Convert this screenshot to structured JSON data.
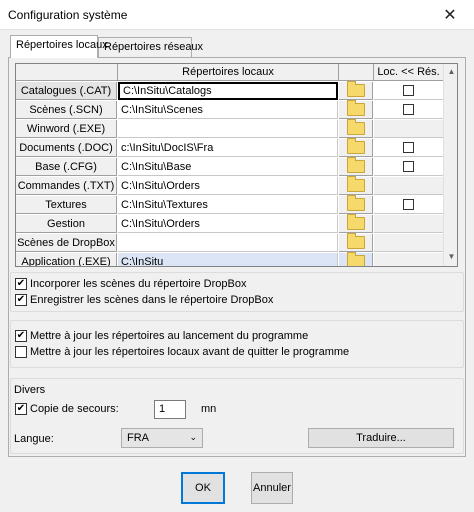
{
  "window": {
    "title": "Configuration système",
    "close_glyph": "✕"
  },
  "tabs": [
    "Répertoires locaux",
    "Répertoires réseaux"
  ],
  "grid": {
    "col_path": "Répertoires locaux",
    "col_loc": "Loc. << Rés.",
    "rows": [
      {
        "label": "Catalogues (.CAT)",
        "path": "C:\\InSitu\\Catalogs",
        "checkbox": true
      },
      {
        "label": "Scènes (.SCN)",
        "path": "C:\\InSitu\\Scenes",
        "checkbox": true
      },
      {
        "label": "Winword (.EXE)",
        "path": "",
        "checkbox": false
      },
      {
        "label": "Documents (.DOC)",
        "path": "c:\\InSitu\\DocIS\\Fra",
        "checkbox": true
      },
      {
        "label": "Base (.CFG)",
        "path": "C:\\InSitu\\Base",
        "checkbox": true
      },
      {
        "label": "Commandes (.TXT)",
        "path": "C:\\InSitu\\Orders",
        "checkbox": false
      },
      {
        "label": "Textures",
        "path": "C:\\InSitu\\Textures",
        "checkbox": true
      },
      {
        "label": "Gestion",
        "path": "C:\\InSitu\\Orders",
        "checkbox": false
      },
      {
        "label": "Scènes de DropBox",
        "path": "",
        "checkbox": false
      },
      {
        "label": "Application (.EXE)",
        "path": "C:\\InSitu",
        "checkbox": false
      }
    ]
  },
  "options": {
    "incorporer": {
      "label": "Incorporer les scènes du répertoire DropBox",
      "checked": true
    },
    "enregistrer": {
      "label": "Enregistrer les scènes dans le répertoire DropBox",
      "checked": true
    },
    "maj_lancement": {
      "label": "Mettre à jour les répertoires au lancement du programme",
      "checked": true
    },
    "maj_quitter": {
      "label": "Mettre à jour les répertoires locaux avant de quitter le programme",
      "checked": false
    }
  },
  "divers": {
    "title": "Divers",
    "copie_label": "Copie de secours:",
    "copie_checked": true,
    "copie_value": "1",
    "copie_unit": "mn",
    "langue_label": "Langue:",
    "langue_value": "FRA",
    "traduire": "Traduire..."
  },
  "buttons": {
    "ok": "OK",
    "cancel": "Annuler"
  }
}
